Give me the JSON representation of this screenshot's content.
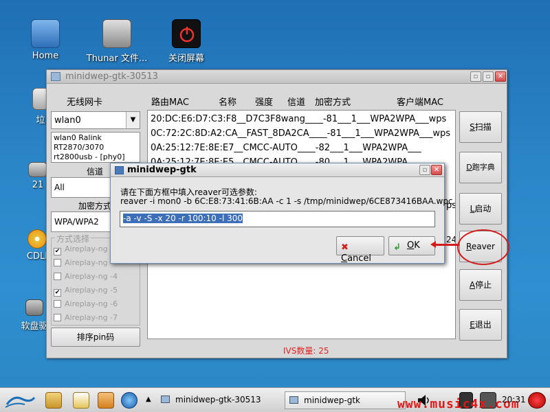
{
  "desktop": {
    "icons": [
      {
        "label": "Home"
      },
      {
        "label": "Thunar 文件..."
      },
      {
        "label": "关闭屏幕"
      }
    ],
    "partial_labels": {
      "trash": "垃",
      "drive": "21",
      "cdlinux": "CDLI",
      "floppy": "软盘驱"
    }
  },
  "main_window": {
    "title": "minidwep-gtk-30513",
    "headers": {
      "wifi_card": "无线网卡",
      "router_mac": "路由MAC",
      "name": "名称",
      "strength": "强度",
      "channel": "信道",
      "encryption": "加密方式",
      "client_mac": "客户端MAC"
    },
    "wifi_card_value": "wlan0",
    "card_info": [
      "wlan0 Ralink",
      "RT2870/3070",
      "rt2800usb - [phy0]"
    ],
    "channel_label": "信道",
    "channel_value": "All",
    "encryption_label": "加密方式",
    "encryption_value": "WPA/WPA2",
    "method_group_label": "方式选择",
    "methods": [
      {
        "label": "Aireplay-ng -",
        "checked": true
      },
      {
        "label": "Aireplay-ng -",
        "checked": false
      },
      {
        "label": "Aireplay-ng -4",
        "checked": false
      },
      {
        "label": "Aireplay-ng -5",
        "checked": true
      },
      {
        "label": "Aireplay-ng -6",
        "checked": false
      },
      {
        "label": "Aireplay-ng -7",
        "checked": false
      }
    ],
    "sort_pin_button": "排序pin码",
    "network_rows": [
      "20:DC:E6:D7:C3:F8__D7C3F8wang____-81___1___WPA2WPA___wps",
      "0C:72:2C:8D:A2:CA__FAST_8DA2CA____-81___1___WPA2WPA___wps",
      "0A:25:12:7E:8E:E7__CMCC-AUTO____-82___1___WPA2WPA___",
      "0A:25:12:7E:8E:E5__CMCC-AUTO____-80___1___WPA2WPA___"
    ],
    "list_partial": {
      "ps": "ps",
      "num": "24"
    },
    "buttons": {
      "scan": {
        "u": "S",
        "rest": "扫描"
      },
      "dict": {
        "u": "D",
        "rest": "跑字典"
      },
      "start": {
        "u": "L",
        "rest": "启动"
      },
      "reaver": {
        "u": "R",
        "rest": "eaver"
      },
      "stop": {
        "u": "A",
        "rest": "停止"
      },
      "exit": {
        "u": "E",
        "rest": "退出"
      }
    },
    "ivs_label": "IVS数量: 25"
  },
  "dialog": {
    "title": "minidwep-gtk",
    "prompt_line1": "请在下面方框中填入reaver可选参数:",
    "prompt_line2": "reaver -i mon0 -b 6C:E8:73:41:6B:AA -c 1 -s /tmp/minidwep/6CE873416BAA.wpc",
    "entry_value": "-a -v -S -x 20 -r 100:10 -l 300",
    "cancel": {
      "u": "C",
      "rest": "ancel"
    },
    "ok": {
      "u": "O",
      "rest": "K"
    }
  },
  "taskbar": {
    "tasks": [
      "minidwep-gtk-30513",
      "minidwep-gtk"
    ],
    "watermark": "www.music4x.com",
    "clock": "20:31"
  }
}
